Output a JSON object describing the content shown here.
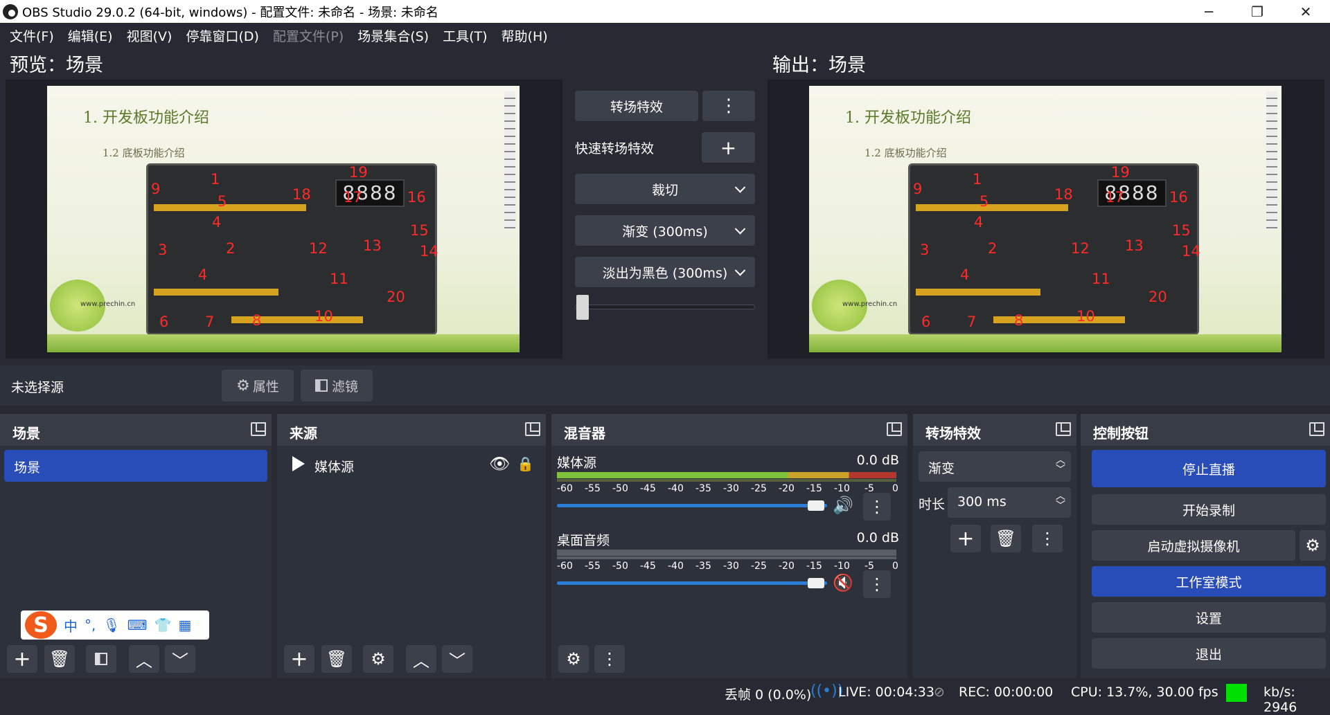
{
  "window": {
    "title": "OBS Studio 29.0.2 (64-bit, windows) - 配置文件: 未命名 - 场景: 未命名",
    "minimize": "─",
    "restore": "❐",
    "close": "✕"
  },
  "menu": [
    {
      "label": "文件(F)",
      "enabled": true
    },
    {
      "label": "编辑(E)",
      "enabled": true
    },
    {
      "label": "视图(V)",
      "enabled": true
    },
    {
      "label": "停靠窗口(D)",
      "enabled": true
    },
    {
      "label": "配置文件(P)",
      "enabled": false
    },
    {
      "label": "场景集合(S)",
      "enabled": true
    },
    {
      "label": "工具(T)",
      "enabled": true
    },
    {
      "label": "帮助(H)",
      "enabled": true
    }
  ],
  "preview": {
    "label": "预览：场景"
  },
  "output": {
    "label": "输出：场景"
  },
  "slide": {
    "title": "1. 开发板功能介绍",
    "subtitle": "1.2 底板功能介绍",
    "seg_display": "8888",
    "footer": "www.prechin.cn",
    "numbers": [
      "1",
      "2",
      "3",
      "4",
      "4",
      "5",
      "6",
      "7",
      "8",
      "9",
      "10",
      "11",
      "12",
      "13",
      "14",
      "15",
      "16",
      "17",
      "18",
      "19",
      "20"
    ]
  },
  "transition_controls": {
    "transition_button": "转场特效",
    "quick_label": "快速转场特效",
    "quick_items": [
      "裁切",
      "渐变 (300ms)",
      "淡出为黑色 (300ms)"
    ],
    "tbar_value": 0
  },
  "source_toolbar": {
    "no_source": "未选择源",
    "properties": "属性",
    "filters": "滤镜"
  },
  "docks": {
    "scenes": {
      "title": "场景",
      "items": [
        "场景"
      ],
      "selected": 0
    },
    "sources": {
      "title": "来源",
      "items": [
        {
          "name": "媒体源",
          "visible": true,
          "locked": true
        }
      ]
    },
    "mixer": {
      "title": "混音器",
      "channels": [
        {
          "name": "媒体源",
          "db": "0.0 dB",
          "muted": false,
          "volume": 1.0
        },
        {
          "name": "桌面音频",
          "db": "0.0 dB",
          "muted": true,
          "volume": 1.0
        }
      ],
      "ticks": [
        "-60",
        "-55",
        "-50",
        "-45",
        "-40",
        "-35",
        "-30",
        "-25",
        "-20",
        "-15",
        "-10",
        "-5",
        "0"
      ]
    },
    "transitions": {
      "title": "转场特效",
      "current": "渐变",
      "duration_label": "时长",
      "duration": "300 ms"
    },
    "controls": {
      "title": "控制按钮",
      "stop_stream": "停止直播",
      "start_record": "开始录制",
      "virtual_cam": "启动虚拟摄像机",
      "studio_mode": "工作室模式",
      "settings": "设置",
      "exit": "退出"
    }
  },
  "ime": {
    "logo": "S",
    "lang": "中",
    "punct": "°,"
  },
  "status": {
    "dropped": "丢帧 0 (0.0%)",
    "live": "LIVE: 00:04:33",
    "rec": "REC: 00:00:00",
    "cpu": "CPU: 13.7%, 30.00 fps",
    "kbs": "kb/s: 2946"
  },
  "colors": {
    "accent": "#284cb8",
    "bg": "#272a33",
    "panel": "#2d313b",
    "button": "#3c404b",
    "health": "#00e000",
    "meter_green": "#7ec23a",
    "meter_yellow": "#c9a22a",
    "meter_red": "#b3362c",
    "mute_red": "#d23b3b"
  }
}
